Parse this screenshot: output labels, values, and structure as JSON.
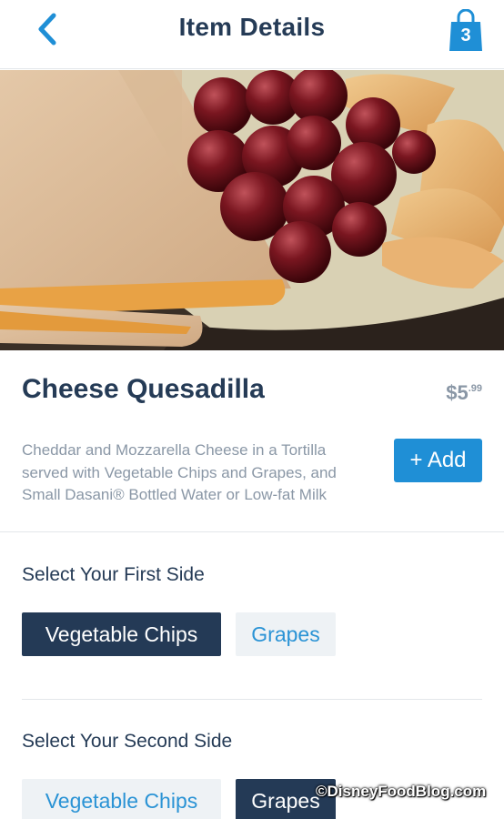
{
  "header": {
    "title": "Item Details",
    "bag_count": "3"
  },
  "colors": {
    "navy": "#253b56",
    "accent_blue": "#1f8fd6",
    "muted_gray": "#8a97a6",
    "chip_unselected_bg": "#eef2f5"
  },
  "item": {
    "name": "Cheese Quesadilla",
    "price_dollars": "$5",
    "price_cents": ".99",
    "description": "Cheddar and Mozzarella Cheese in a Tortilla served with Vegetable Chips and Grapes, and Small Dasani® Bottled Water or Low-fat Milk",
    "add_label": "+ Add"
  },
  "first_side": {
    "heading": "Select Your First Side",
    "options": [
      {
        "label": "Vegetable Chips",
        "selected": true
      },
      {
        "label": "Grapes",
        "selected": false
      }
    ]
  },
  "second_side": {
    "heading": "Select Your Second Side",
    "options": [
      {
        "label": "Vegetable Chips",
        "selected": false
      },
      {
        "label": "Grapes",
        "selected": true
      }
    ]
  },
  "watermark": "©DisneyFoodBlog.com"
}
